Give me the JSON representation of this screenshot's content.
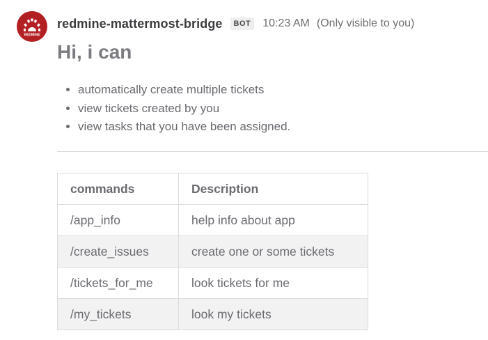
{
  "author": {
    "name": "redmine-mattermost-bridge",
    "badge": "BOT",
    "avatar_icon": "redmine-logo-icon",
    "avatar_text": "REDMINE",
    "avatar_color": "#b32024"
  },
  "post": {
    "time": "10:23 AM",
    "visibility": "(Only visible to you)",
    "heading": "Hi, i can",
    "bullets": [
      "automatically create multiple tickets",
      "view tickets created by you",
      "view tasks that you have been assigned."
    ]
  },
  "table": {
    "headers": [
      "commands",
      "Description"
    ],
    "rows": [
      [
        "/app_info",
        "help info about app"
      ],
      [
        "/create_issues",
        "create one or some tickets"
      ],
      [
        "/tickets_for_me",
        "look tickets for me"
      ],
      [
        "/my_tickets",
        "look my tickets"
      ]
    ]
  }
}
